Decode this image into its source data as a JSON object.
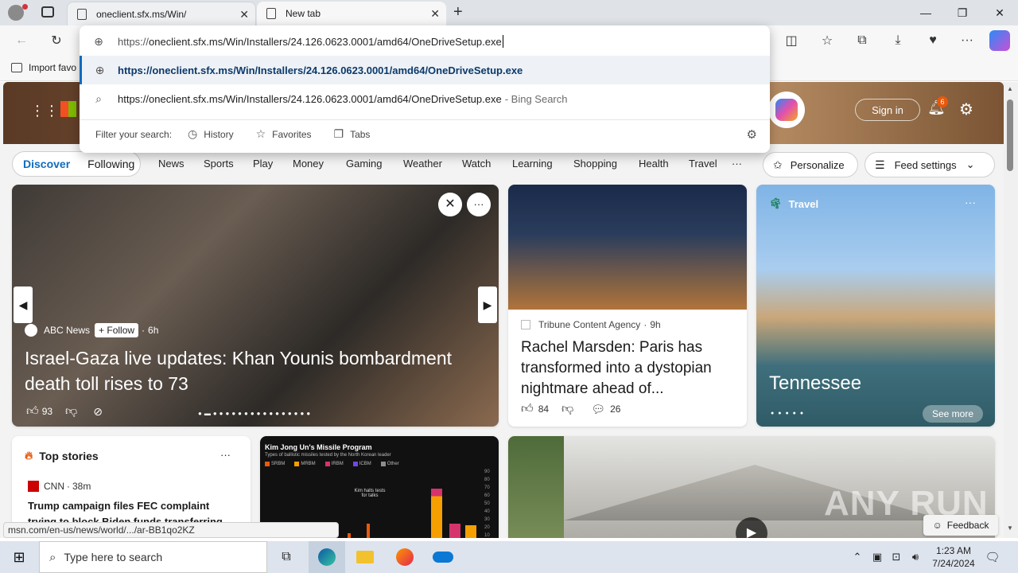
{
  "tabs": [
    {
      "title": "oneclient.sfx.ms/Win/",
      "active": false
    },
    {
      "title": "New tab",
      "active": true
    }
  ],
  "window_controls": {
    "minimize": "—",
    "maximize": "❐",
    "close": "✕"
  },
  "address": {
    "prefix": "https://",
    "value": "oneclient.sfx.ms/Win/Installers/24.126.0623.0001/amd64/OneDriveSetup.exe"
  },
  "suggestions": [
    {
      "icon": "globe-icon",
      "text": "https://oneclient.sfx.ms/Win/Installers/24.126.0623.0001/amd64/OneDriveSetup.exe"
    },
    {
      "icon": "search-icon",
      "text": "https://oneclient.sfx.ms/Win/Installers/24.126.0623.0001/amd64/OneDriveSetup.exe",
      "suffix": "- Bing Search"
    }
  ],
  "filter": {
    "label": "Filter your search:",
    "history": "History",
    "favorites": "Favorites",
    "tabs": "Tabs"
  },
  "favorites_bar": {
    "import": "Import favo"
  },
  "msn": {
    "sign_in": "Sign in",
    "notif_count": "6",
    "feed_tabs": [
      "Discover",
      "Following"
    ],
    "nav": [
      "News",
      "Sports",
      "Play",
      "Money",
      "Gaming",
      "Weather",
      "Watch",
      "Learning",
      "Shopping",
      "Health",
      "Travel"
    ],
    "more": "···",
    "personalize": "Personalize",
    "feed_settings": "Feed settings"
  },
  "hero": {
    "source": "ABC News",
    "follow": "+ Follow",
    "age": "6h",
    "headline": "Israel-Gaza live updates: Khan Younis bombardment death toll rises to 73",
    "likes": "93"
  },
  "card2": {
    "source": "Tribune Content Agency",
    "age": "9h",
    "headline": "Rachel Marsden: Paris has transformed into a dystopian nightmare ahead of...",
    "likes": "84",
    "comments": "26"
  },
  "travel": {
    "label": "Travel",
    "place": "Tennessee",
    "see_more": "See more"
  },
  "top_stories": {
    "title": "Top stories",
    "source": "CNN",
    "age": "38m",
    "headline": "Trump campaign files FEC complaint trying to block Biden funds transferring"
  },
  "missile_card": {
    "title": "Kim Jong Un's Missile Program",
    "subtitle": "Types of ballistic missiles tested by the North Korean leader",
    "legend": [
      "SRBM",
      "MRBM",
      "IRBM",
      "ICBM",
      "Other"
    ],
    "annotation": "Kim halts tests for talks",
    "y_ticks": [
      "90",
      "80",
      "70",
      "60",
      "50",
      "40",
      "30",
      "20",
      "10"
    ]
  },
  "feedback": "Feedback",
  "status_url": "msn.com/en-us/news/world/.../ar-BB1qo2KZ",
  "watermark": "ANY RUN",
  "taskbar": {
    "search_placeholder": "Type here to search",
    "time": "1:23 AM",
    "date": "7/24/2024"
  },
  "colors": {
    "accent": "#0f6cbd",
    "taskbar": "#dde4ee",
    "tabstrip": "#dfe3e8"
  }
}
